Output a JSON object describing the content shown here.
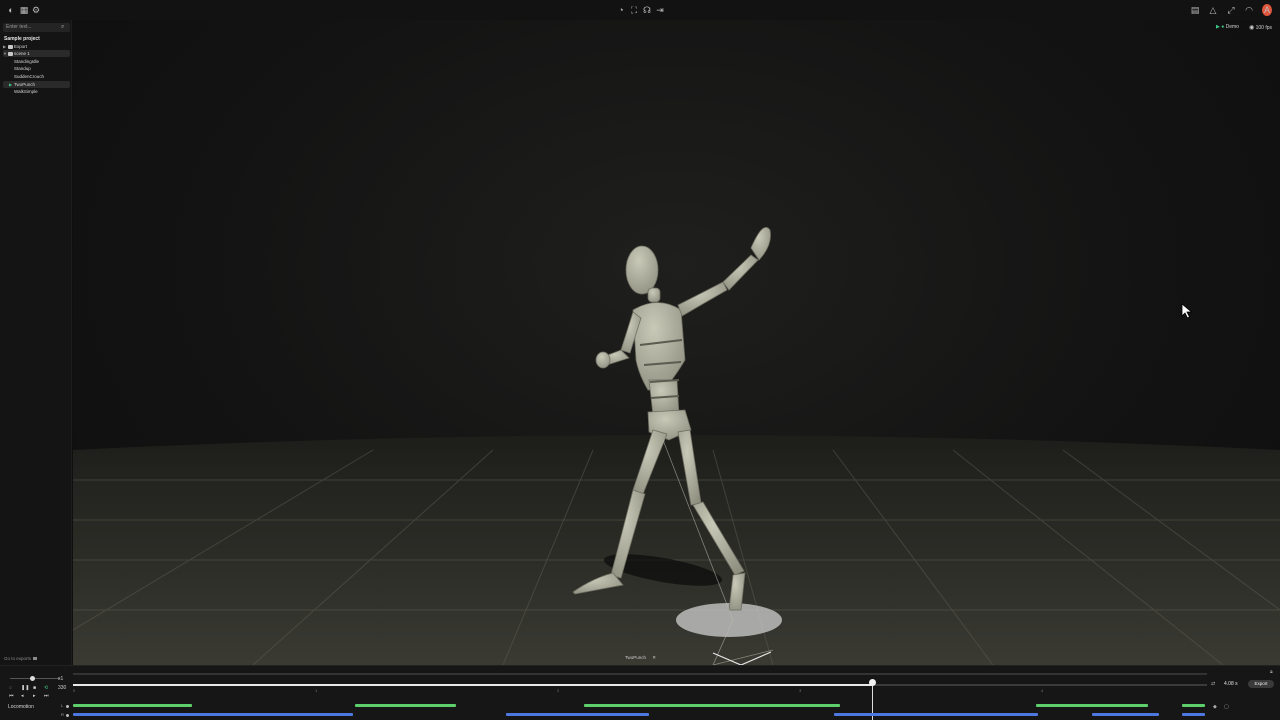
{
  "topbar": {
    "left_icons": [
      "app-logo-icon",
      "grid-icon",
      "gear-icon"
    ],
    "center_icons": [
      "pose-icon",
      "frame-icon",
      "headphones-icon",
      "flow-icon"
    ],
    "right_icons": [
      "layers-icon",
      "warning-icon",
      "fullscreen-icon",
      "wifi-icon"
    ],
    "avatar_letter": "A"
  },
  "sidebar": {
    "search_placeholder": "Enter text...",
    "project_title": "Sample project",
    "items": [
      {
        "label": "Export",
        "type": "folder"
      },
      {
        "label": "scene 1",
        "type": "folder"
      },
      {
        "label": "StandingIdle",
        "type": "clip"
      },
      {
        "label": "Standup",
        "type": "clip"
      },
      {
        "label": "SuddenCrouch",
        "type": "clip"
      },
      {
        "label": "TwoPunch",
        "type": "clip"
      },
      {
        "label": "WalkSimple",
        "type": "clip"
      }
    ],
    "goto_label": "Go to exports"
  },
  "viewport": {
    "mode_label": "Demo",
    "fps_label": "100 fps",
    "clip_tag": "TwoPunch",
    "clip_tag_close": "✕"
  },
  "timeline": {
    "speed_label": "x1",
    "frame_count": "330",
    "time_readout": "4.08 s",
    "export_label": "Export",
    "ruler_ticks": [
      "0",
      "1",
      "2",
      "3",
      "4"
    ],
    "progress": 0.705,
    "track_name": "Locomotion",
    "lanes": [
      {
        "letter": "L",
        "color": "#5ed06b",
        "segments": [
          [
            0.0,
            0.105
          ],
          [
            0.249,
            0.338
          ],
          [
            0.451,
            0.676
          ],
          [
            0.849,
            0.948
          ],
          [
            0.978,
            0.998
          ]
        ]
      },
      {
        "letter": "R",
        "color": "#4c78e0",
        "segments": [
          [
            0.0,
            0.247
          ],
          [
            0.382,
            0.508
          ],
          [
            0.671,
            0.851
          ],
          [
            0.899,
            0.958
          ],
          [
            0.978,
            0.998
          ]
        ]
      }
    ]
  }
}
